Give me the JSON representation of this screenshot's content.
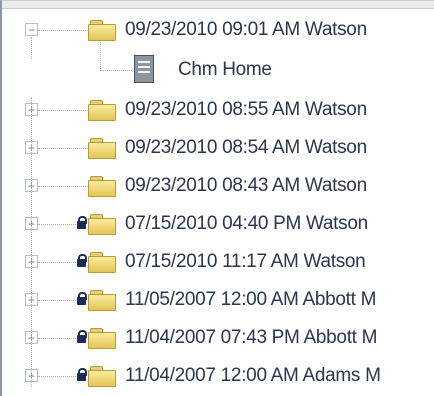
{
  "tree": {
    "items": [
      {
        "label": "09/23/2010 09:01 AM Watson",
        "expander": "−",
        "locked": false,
        "kind": "folder"
      },
      {
        "label": "Chm Home",
        "expander": "",
        "locked": false,
        "kind": "document"
      },
      {
        "label": "09/23/2010 08:55 AM Watson",
        "expander": "+",
        "locked": false,
        "kind": "folder"
      },
      {
        "label": "09/23/2010 08:54 AM Watson",
        "expander": "+",
        "locked": false,
        "kind": "folder"
      },
      {
        "label": "09/23/2010 08:43 AM Watson",
        "expander": "+",
        "locked": false,
        "kind": "folder"
      },
      {
        "label": "07/15/2010 04:40 PM Watson",
        "expander": "+",
        "locked": true,
        "kind": "folder"
      },
      {
        "label": "07/15/2010 11:17 AM Watson",
        "expander": "+",
        "locked": true,
        "kind": "folder"
      },
      {
        "label": "11/05/2007 12:00 AM Abbott M",
        "expander": "+",
        "locked": true,
        "kind": "folder"
      },
      {
        "label": "11/04/2007 07:43 PM Abbott M",
        "expander": "+",
        "locked": true,
        "kind": "folder"
      },
      {
        "label": "11/04/2007 12:00 AM Adams M",
        "expander": "+",
        "locked": true,
        "kind": "folder"
      }
    ]
  }
}
